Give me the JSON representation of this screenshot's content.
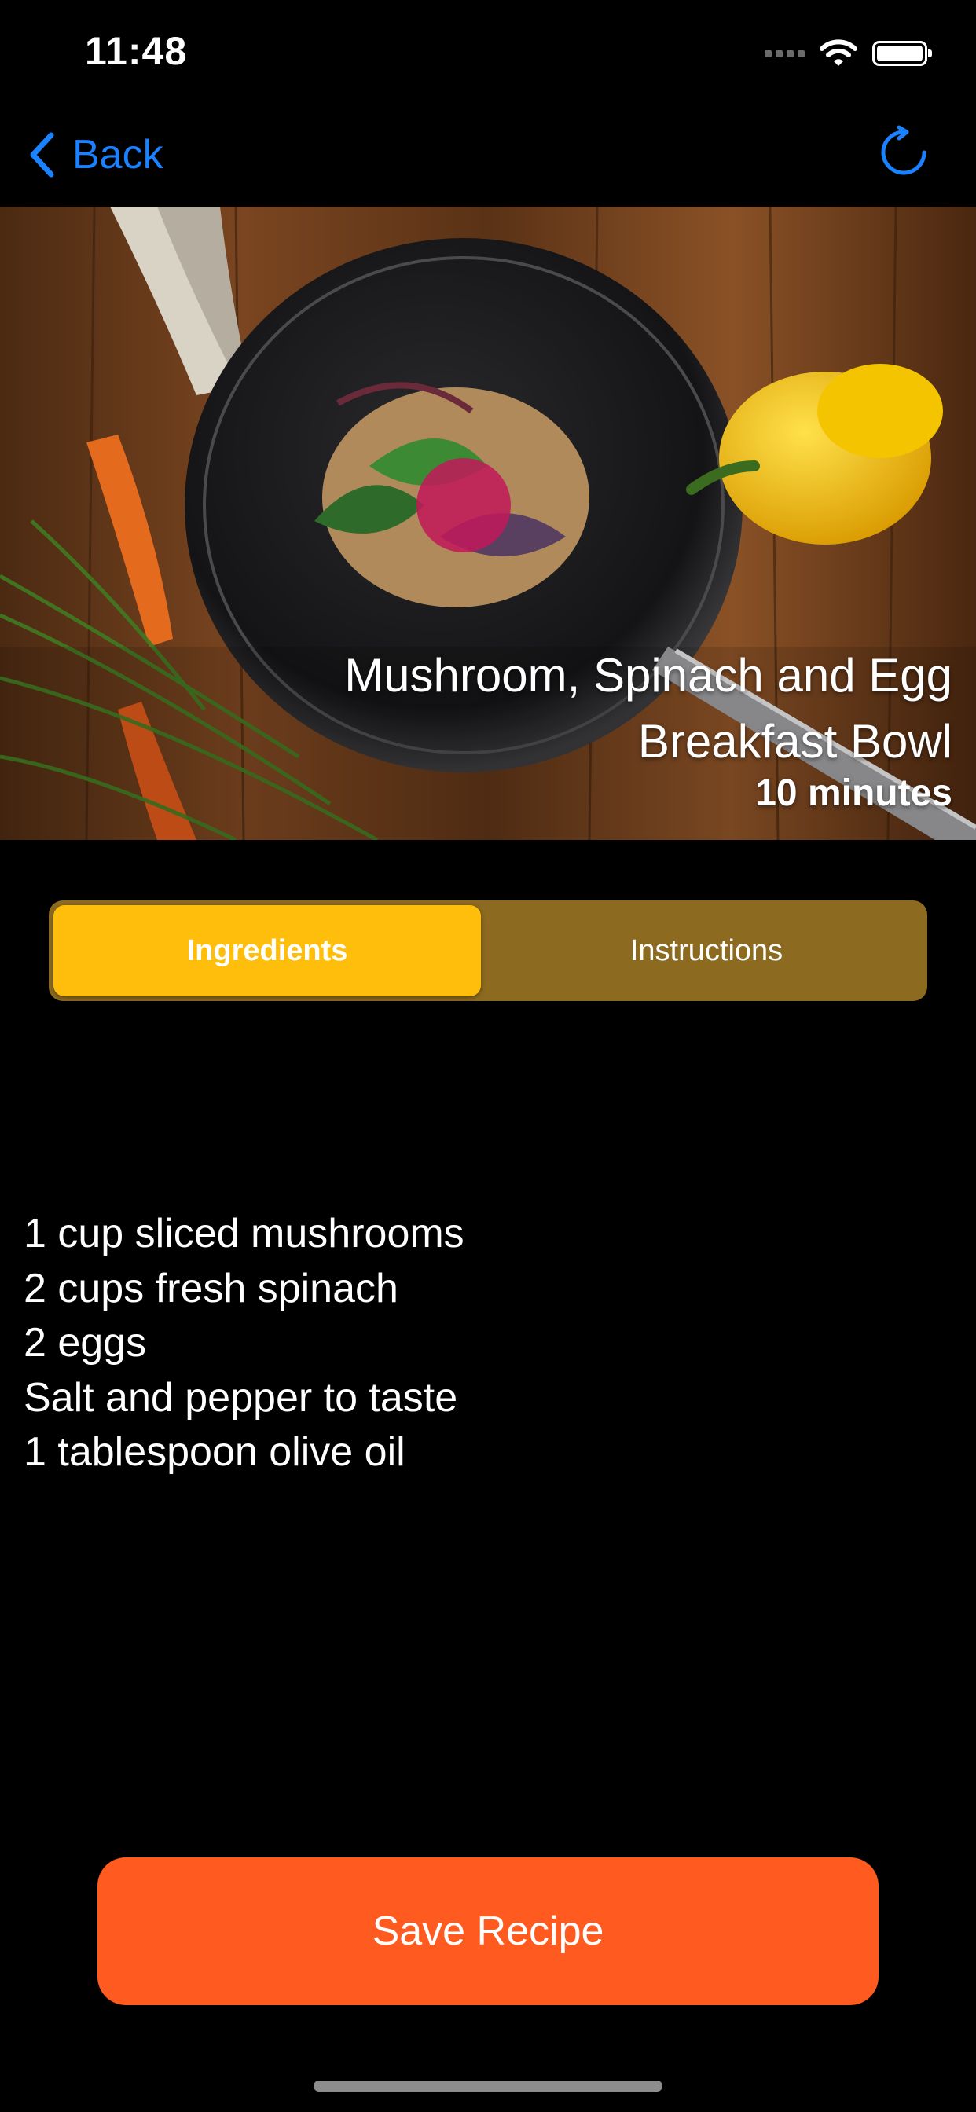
{
  "status_bar": {
    "time": "11:48"
  },
  "nav": {
    "back_label": "Back",
    "accent_color": "#1a82ff"
  },
  "recipe": {
    "title_line1": "Mushroom, Spinach and Egg",
    "title_line2": "Breakfast Bowl",
    "time": "10 minutes"
  },
  "tabs": {
    "ingredients_label": "Ingredients",
    "instructions_label": "Instructions",
    "selected": "Ingredients"
  },
  "ingredients": [
    "1 cup sliced mushrooms",
    "2 cups fresh spinach",
    "2 eggs",
    "Salt and pepper to taste",
    "1 tablespoon olive oil"
  ],
  "actions": {
    "save_label": "Save Recipe",
    "save_color": "#ff5a20"
  },
  "icons": {
    "back": "chevron-left-icon",
    "refresh": "refresh-icon",
    "wifi": "wifi-icon",
    "battery": "battery-icon",
    "signal": "signal-icon"
  }
}
